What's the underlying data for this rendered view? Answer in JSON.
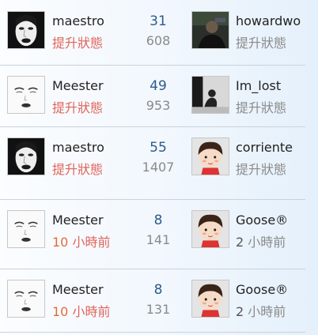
{
  "rows": [
    {
      "left": {
        "name": "maestro",
        "status": "提升狀態",
        "status_type": "warn",
        "avatar": "woman-dark-lips-avatar"
      },
      "stats": {
        "primary": "31",
        "secondary": "608"
      },
      "right": {
        "name": "howardwo",
        "status": "提升狀態",
        "status_type": "muted",
        "avatar": "man-dark-photo-avatar"
      }
    },
    {
      "left": {
        "name": "Meester",
        "status": "提升狀態",
        "status_type": "warn",
        "avatar": "face-sketch-avatar"
      },
      "stats": {
        "primary": "49",
        "secondary": "953"
      },
      "right": {
        "name": "Im_lost",
        "status": "提升狀態",
        "status_type": "muted",
        "avatar": "sitting-figure-avatar"
      }
    },
    {
      "left": {
        "name": "maestro",
        "status": "提升狀態",
        "status_type": "warn",
        "avatar": "woman-dark-lips-avatar"
      },
      "stats": {
        "primary": "55",
        "secondary": "1407"
      },
      "right": {
        "name": "corriente",
        "status": "提升狀態",
        "status_type": "muted",
        "avatar": "cartoon-boy-avatar"
      }
    },
    {
      "left": {
        "name": "Meester",
        "status_num": "10",
        "status_unit": "小時前",
        "status_type": "warn",
        "avatar": "face-sketch-avatar"
      },
      "stats": {
        "primary": "8",
        "secondary": "141"
      },
      "right": {
        "name": "Goose®",
        "status_num": "2",
        "status_unit": "小時前",
        "status_type": "muted",
        "avatar": "cartoon-boy-avatar"
      }
    },
    {
      "left": {
        "name": "Meester",
        "status_num": "10",
        "status_unit": "小時前",
        "status_type": "warn",
        "avatar": "face-sketch-avatar"
      },
      "stats": {
        "primary": "8",
        "secondary": "131"
      },
      "right": {
        "name": "Goose®",
        "status_num": "2",
        "status_unit": "小時前",
        "status_type": "muted",
        "avatar": "cartoon-boy-avatar"
      }
    }
  ],
  "colors": {
    "warn": "#e0645a",
    "count": "#2d5b8c",
    "muted": "#8a8a8a",
    "divider": "#c9d2dc"
  }
}
